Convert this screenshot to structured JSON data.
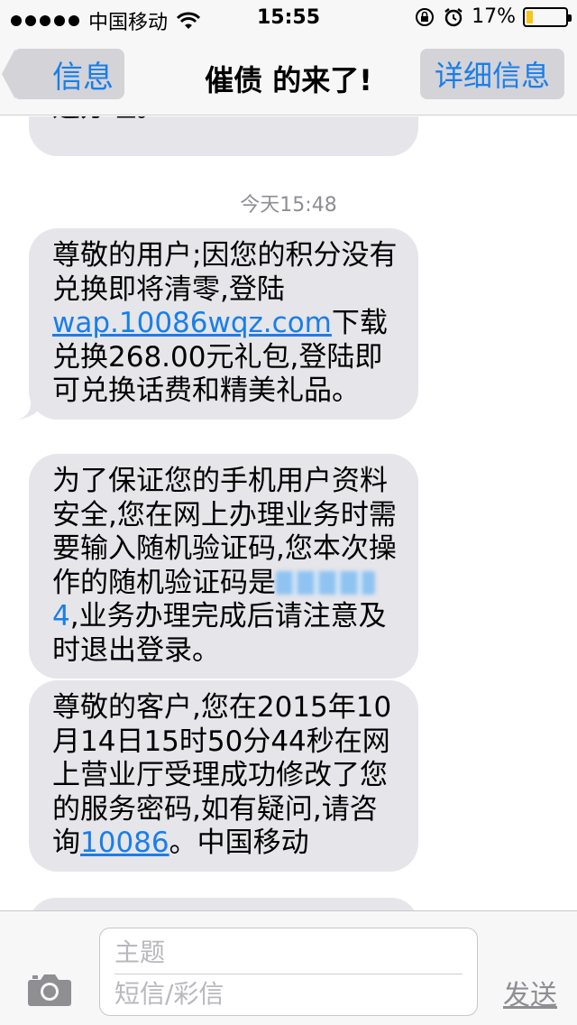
{
  "status_bar": {
    "carrier": "中国移动",
    "time": "15:55",
    "battery_text": "17%",
    "battery_level": 0.17,
    "battery_color": "#f5c518"
  },
  "nav": {
    "back_label": "信息",
    "title": "催债 的来了!",
    "detail_label": "详细信息"
  },
  "messages": {
    "partial_top": "速办理。",
    "timestamp": "今天15:48",
    "msg1": {
      "text_a": "尊敬的用户;因您的积分没有兑换即将清零,登陆",
      "link": "wap.10086wqz.com",
      "text_b": "下载兑换268.00元礼包,登陆即可兑换话费和精美礼品。"
    },
    "msg2": {
      "text_a": "为了保证您的手机用户资料安全,您在网上办理业务时需要输入随机验证码,您本次操作的随机验证码是",
      "code_tail": "4",
      "text_b": ",业务办理完成后请注意及时退出登录。"
    },
    "msg3": {
      "text_a": "尊敬的客户,您在2015年10月14日15时50分44秒在网上营业厅受理成功修改了您的服务密码,如有疑问,请咨询",
      "link": "10086",
      "text_b": "。中国移动"
    }
  },
  "input_bar": {
    "subject_placeholder": "主题",
    "body_placeholder": "短信/彩信",
    "send_label": "发送"
  },
  "colors": {
    "accent": "#1a7ee8",
    "bubble": "#e5e5ea",
    "bar_bg": "#f7f7f7"
  },
  "icons": [
    "wifi-icon",
    "rotation-lock-icon",
    "alarm-icon",
    "battery-icon",
    "back-chevron-icon",
    "camera-icon"
  ]
}
